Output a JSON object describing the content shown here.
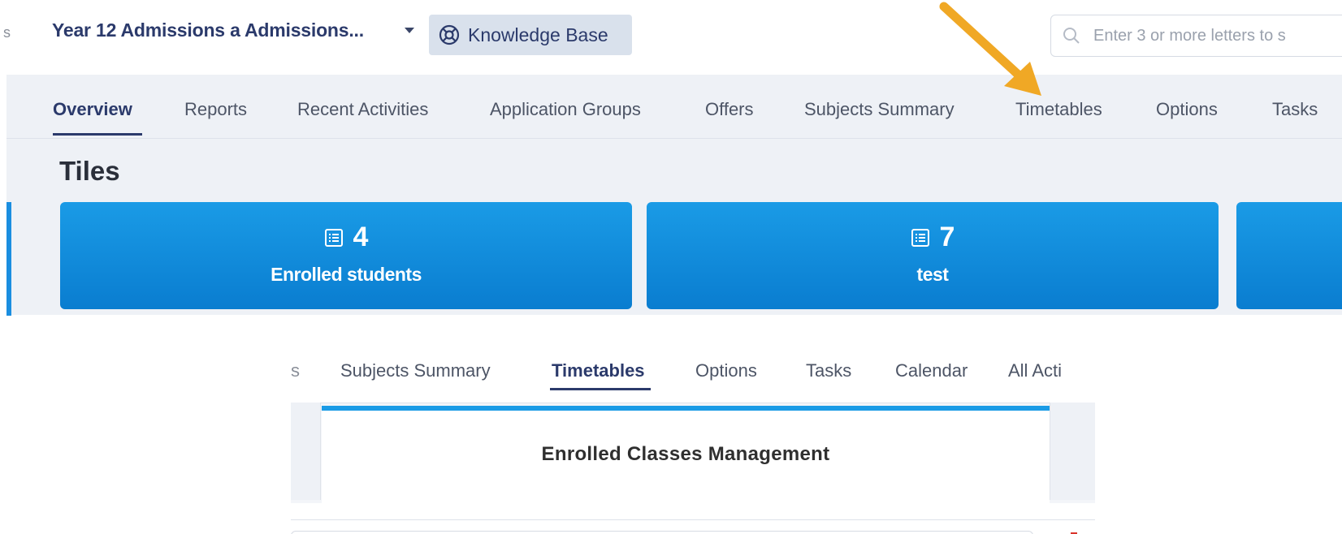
{
  "top_header": {
    "cut_text": "s",
    "breadcrumb": "Year 12 Admissions a Admissions...",
    "knowledge_base_label": "Knowledge Base",
    "search_placeholder": "Enter 3 or more letters to s"
  },
  "top_nav": {
    "tabs": [
      {
        "label": "Overview",
        "active": true
      },
      {
        "label": "Reports"
      },
      {
        "label": "Recent Activities"
      },
      {
        "label": "Application Groups"
      },
      {
        "label": "Offers"
      },
      {
        "label": "Subjects Summary"
      },
      {
        "label": "Timetables"
      },
      {
        "label": "Options"
      },
      {
        "label": "Tasks"
      }
    ]
  },
  "tiles": {
    "heading": "Tiles",
    "items": [
      {
        "count": "4",
        "label": "Enrolled students"
      },
      {
        "count": "7",
        "label": "test"
      }
    ]
  },
  "bottom_nav": {
    "cut_text": "s",
    "tabs": [
      {
        "label": "Subjects Summary"
      },
      {
        "label": "Timetables",
        "active": true
      },
      {
        "label": "Options"
      },
      {
        "label": "Tasks"
      },
      {
        "label": "Calendar"
      },
      {
        "label": "All Acti"
      }
    ]
  },
  "bottom_card": {
    "title": "Enrolled Classes Management"
  },
  "colors": {
    "tile_blue": "#0a7dd0",
    "nav_active": "#2b3a6b",
    "arrow": "#f0a825",
    "card_accent": "#1a9be6"
  }
}
